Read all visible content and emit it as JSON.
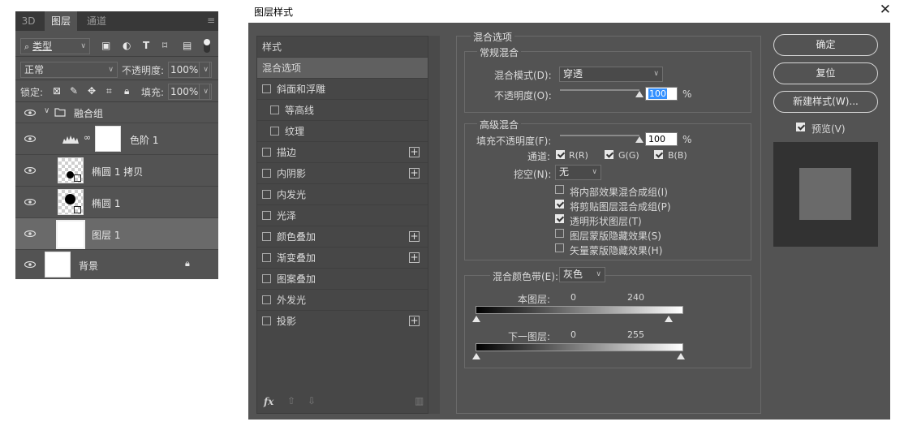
{
  "layers_panel": {
    "tabs": [
      "3D",
      "图层",
      "通道"
    ],
    "filter_type": "类型",
    "blend_mode": "正常",
    "opacity_label": "不透明度:",
    "opacity_value": "100%",
    "lock_label": "锁定:",
    "fill_label": "填充:",
    "fill_value": "100%",
    "layers": [
      {
        "name": "融合组",
        "kind": "group"
      },
      {
        "name": "色阶 1",
        "kind": "adjustment"
      },
      {
        "name": "椭圆 1 拷贝",
        "kind": "shape"
      },
      {
        "name": "椭圆 1",
        "kind": "shape"
      },
      {
        "name": "图层 1",
        "kind": "layer",
        "selected": true
      },
      {
        "name": "背景",
        "kind": "background"
      }
    ]
  },
  "dialog": {
    "title": "图层样式",
    "style_list": [
      {
        "label": "样式",
        "checkbox": false,
        "plus": false
      },
      {
        "label": "混合选项",
        "checkbox": false,
        "plus": false,
        "selected": true
      },
      {
        "label": "斜面和浮雕",
        "checkbox": true,
        "plus": false
      },
      {
        "label": "等高线",
        "checkbox": true,
        "plus": false,
        "indent": true
      },
      {
        "label": "纹理",
        "checkbox": true,
        "plus": false,
        "indent": true
      },
      {
        "label": "描边",
        "checkbox": true,
        "plus": true
      },
      {
        "label": "内阴影",
        "checkbox": true,
        "plus": true
      },
      {
        "label": "内发光",
        "checkbox": true,
        "plus": false
      },
      {
        "label": "光泽",
        "checkbox": true,
        "plus": false
      },
      {
        "label": "颜色叠加",
        "checkbox": true,
        "plus": true
      },
      {
        "label": "渐变叠加",
        "checkbox": true,
        "plus": true
      },
      {
        "label": "图案叠加",
        "checkbox": true,
        "plus": false
      },
      {
        "label": "外发光",
        "checkbox": true,
        "plus": false
      },
      {
        "label": "投影",
        "checkbox": true,
        "plus": true
      }
    ],
    "fx_label": "fx",
    "blend_options": {
      "section_title": "混合选项",
      "general_title": "常规混合",
      "blend_mode_label": "混合模式(D):",
      "blend_mode_value": "穿透",
      "opacity_label": "不透明度(O):",
      "opacity_value": "100",
      "opacity_level": 1.0,
      "percent": "%",
      "advanced_title": "高级混合",
      "fill_opacity_label": "填充不透明度(F):",
      "fill_opacity_value": "100",
      "fill_opacity_level": 1.0,
      "channels_label": "通道:",
      "channel_r": "R(R)",
      "channel_g": "G(G)",
      "channel_b": "B(B)",
      "knockout_label": "挖空(N):",
      "knockout_value": "无",
      "options": [
        {
          "label": "将内部效果混合成组(I)",
          "checked": false
        },
        {
          "label": "将剪贴图层混合成组(P)",
          "checked": true
        },
        {
          "label": "透明形状图层(T)",
          "checked": true
        },
        {
          "label": "图层蒙版隐藏效果(S)",
          "checked": false
        },
        {
          "label": "矢量蒙版隐藏效果(H)",
          "checked": false
        }
      ],
      "blend_if_label": "混合颜色带(E):",
      "blend_if_value": "灰色",
      "this_layer_label": "本图层:",
      "this_layer_min": "0",
      "this_layer_max": "240",
      "under_layer_label": "下一图层:",
      "under_layer_min": "0",
      "under_layer_max": "255"
    },
    "buttons": {
      "ok": "确定",
      "reset": "复位",
      "new_style": "新建样式(W)...",
      "preview_label": "预览(V)"
    }
  }
}
